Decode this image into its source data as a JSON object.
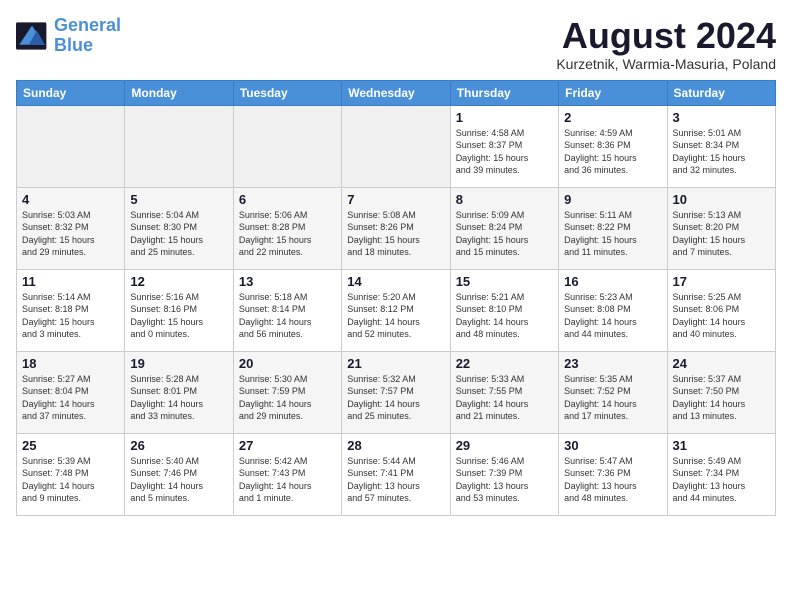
{
  "header": {
    "logo_line1": "General",
    "logo_line2": "Blue",
    "month": "August 2024",
    "location": "Kurzetnik, Warmia-Masuria, Poland"
  },
  "weekdays": [
    "Sunday",
    "Monday",
    "Tuesday",
    "Wednesday",
    "Thursday",
    "Friday",
    "Saturday"
  ],
  "weeks": [
    [
      {
        "day": "",
        "info": ""
      },
      {
        "day": "",
        "info": ""
      },
      {
        "day": "",
        "info": ""
      },
      {
        "day": "",
        "info": ""
      },
      {
        "day": "1",
        "info": "Sunrise: 4:58 AM\nSunset: 8:37 PM\nDaylight: 15 hours\nand 39 minutes."
      },
      {
        "day": "2",
        "info": "Sunrise: 4:59 AM\nSunset: 8:36 PM\nDaylight: 15 hours\nand 36 minutes."
      },
      {
        "day": "3",
        "info": "Sunrise: 5:01 AM\nSunset: 8:34 PM\nDaylight: 15 hours\nand 32 minutes."
      }
    ],
    [
      {
        "day": "4",
        "info": "Sunrise: 5:03 AM\nSunset: 8:32 PM\nDaylight: 15 hours\nand 29 minutes."
      },
      {
        "day": "5",
        "info": "Sunrise: 5:04 AM\nSunset: 8:30 PM\nDaylight: 15 hours\nand 25 minutes."
      },
      {
        "day": "6",
        "info": "Sunrise: 5:06 AM\nSunset: 8:28 PM\nDaylight: 15 hours\nand 22 minutes."
      },
      {
        "day": "7",
        "info": "Sunrise: 5:08 AM\nSunset: 8:26 PM\nDaylight: 15 hours\nand 18 minutes."
      },
      {
        "day": "8",
        "info": "Sunrise: 5:09 AM\nSunset: 8:24 PM\nDaylight: 15 hours\nand 15 minutes."
      },
      {
        "day": "9",
        "info": "Sunrise: 5:11 AM\nSunset: 8:22 PM\nDaylight: 15 hours\nand 11 minutes."
      },
      {
        "day": "10",
        "info": "Sunrise: 5:13 AM\nSunset: 8:20 PM\nDaylight: 15 hours\nand 7 minutes."
      }
    ],
    [
      {
        "day": "11",
        "info": "Sunrise: 5:14 AM\nSunset: 8:18 PM\nDaylight: 15 hours\nand 3 minutes."
      },
      {
        "day": "12",
        "info": "Sunrise: 5:16 AM\nSunset: 8:16 PM\nDaylight: 15 hours\nand 0 minutes."
      },
      {
        "day": "13",
        "info": "Sunrise: 5:18 AM\nSunset: 8:14 PM\nDaylight: 14 hours\nand 56 minutes."
      },
      {
        "day": "14",
        "info": "Sunrise: 5:20 AM\nSunset: 8:12 PM\nDaylight: 14 hours\nand 52 minutes."
      },
      {
        "day": "15",
        "info": "Sunrise: 5:21 AM\nSunset: 8:10 PM\nDaylight: 14 hours\nand 48 minutes."
      },
      {
        "day": "16",
        "info": "Sunrise: 5:23 AM\nSunset: 8:08 PM\nDaylight: 14 hours\nand 44 minutes."
      },
      {
        "day": "17",
        "info": "Sunrise: 5:25 AM\nSunset: 8:06 PM\nDaylight: 14 hours\nand 40 minutes."
      }
    ],
    [
      {
        "day": "18",
        "info": "Sunrise: 5:27 AM\nSunset: 8:04 PM\nDaylight: 14 hours\nand 37 minutes."
      },
      {
        "day": "19",
        "info": "Sunrise: 5:28 AM\nSunset: 8:01 PM\nDaylight: 14 hours\nand 33 minutes."
      },
      {
        "day": "20",
        "info": "Sunrise: 5:30 AM\nSunset: 7:59 PM\nDaylight: 14 hours\nand 29 minutes."
      },
      {
        "day": "21",
        "info": "Sunrise: 5:32 AM\nSunset: 7:57 PM\nDaylight: 14 hours\nand 25 minutes."
      },
      {
        "day": "22",
        "info": "Sunrise: 5:33 AM\nSunset: 7:55 PM\nDaylight: 14 hours\nand 21 minutes."
      },
      {
        "day": "23",
        "info": "Sunrise: 5:35 AM\nSunset: 7:52 PM\nDaylight: 14 hours\nand 17 minutes."
      },
      {
        "day": "24",
        "info": "Sunrise: 5:37 AM\nSunset: 7:50 PM\nDaylight: 14 hours\nand 13 minutes."
      }
    ],
    [
      {
        "day": "25",
        "info": "Sunrise: 5:39 AM\nSunset: 7:48 PM\nDaylight: 14 hours\nand 9 minutes."
      },
      {
        "day": "26",
        "info": "Sunrise: 5:40 AM\nSunset: 7:46 PM\nDaylight: 14 hours\nand 5 minutes."
      },
      {
        "day": "27",
        "info": "Sunrise: 5:42 AM\nSunset: 7:43 PM\nDaylight: 14 hours\nand 1 minute."
      },
      {
        "day": "28",
        "info": "Sunrise: 5:44 AM\nSunset: 7:41 PM\nDaylight: 13 hours\nand 57 minutes."
      },
      {
        "day": "29",
        "info": "Sunrise: 5:46 AM\nSunset: 7:39 PM\nDaylight: 13 hours\nand 53 minutes."
      },
      {
        "day": "30",
        "info": "Sunrise: 5:47 AM\nSunset: 7:36 PM\nDaylight: 13 hours\nand 48 minutes."
      },
      {
        "day": "31",
        "info": "Sunrise: 5:49 AM\nSunset: 7:34 PM\nDaylight: 13 hours\nand 44 minutes."
      }
    ]
  ]
}
